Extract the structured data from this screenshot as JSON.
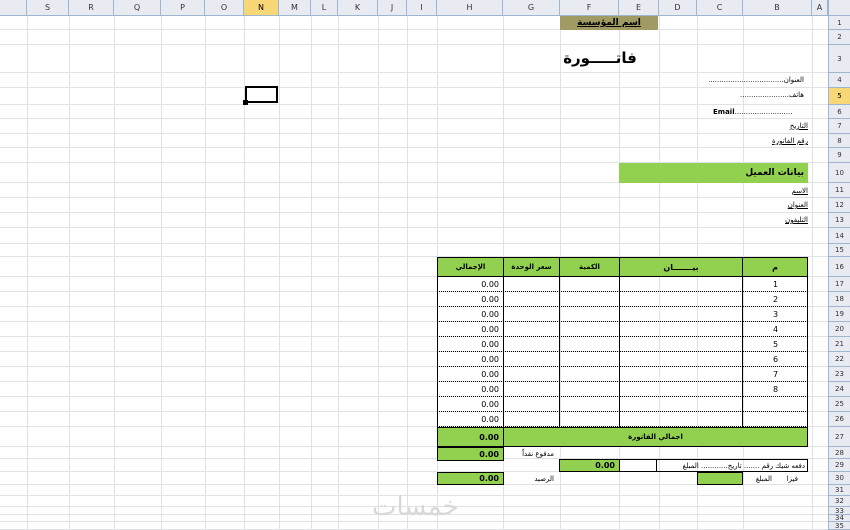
{
  "columns": [
    "A",
    "B",
    "C",
    "D",
    "E",
    "F",
    "G",
    "H",
    "I",
    "J",
    "K",
    "L",
    "M",
    "N",
    "O",
    "P",
    "Q",
    "R",
    "S"
  ],
  "active_column": "N",
  "rows": [
    "1",
    "2",
    "3",
    "4",
    "5",
    "6",
    "7",
    "8",
    "9",
    "10",
    "11",
    "12",
    "13",
    "14",
    "15",
    "16",
    "17",
    "18",
    "19",
    "20",
    "21",
    "22",
    "23",
    "24",
    "25",
    "26",
    "27",
    "28",
    "29",
    "30",
    "31",
    "32",
    "33",
    "34",
    "35"
  ],
  "active_row": "5",
  "header": {
    "company_name": "اسم المؤسسة",
    "invoice_title": "فاتـــــورة",
    "address_label": "العنوان",
    "address_dashes": "..................................",
    "phone_label": "هاتف",
    "phone_dots": "......................",
    "email_label": "Email",
    "email_dots": "..........................",
    "date_label": "التاريخ",
    "invoice_no_label": "رقم الفاتورة"
  },
  "customer": {
    "section_title": "بيانات العميل",
    "name_label": "الاسم",
    "address_label": "العنوان",
    "phone_label": "التليفون"
  },
  "table": {
    "headers": {
      "index": "م",
      "description": "بيـــــــان",
      "quantity": "الكمية",
      "unit_price": "سعر الوحدة",
      "total": "الإجمالي"
    },
    "rows": [
      {
        "index": "1",
        "total": "0.00"
      },
      {
        "index": "2",
        "total": "0.00"
      },
      {
        "index": "3",
        "total": "0.00"
      },
      {
        "index": "4",
        "total": "0.00"
      },
      {
        "index": "5",
        "total": "0.00"
      },
      {
        "index": "6",
        "total": "0.00"
      },
      {
        "index": "7",
        "total": "0.00"
      },
      {
        "index": "8",
        "total": "0.00"
      },
      {
        "index": "",
        "total": "0.00"
      },
      {
        "index": "",
        "total": "0.00"
      }
    ],
    "invoice_total_label": "اجمالي الفاتورة",
    "invoice_total_value": "0.00",
    "cash_paid_label": "مدفوع نقداً",
    "cash_paid_value": "0.00",
    "cheque_text": "دفعه شيك رقم ....... تاريخ............ المبلغ",
    "cheque_value": "0.00",
    "visa_label": "فيزا",
    "amount_label": "المبلغ",
    "balance_label": "الرصيد",
    "balance_value": "0.00"
  },
  "watermark": "خمسات",
  "colors": {
    "green": "#92d050",
    "olive": "#a09a64",
    "header_bg": "#e8ecf2",
    "active": "#f8d776"
  }
}
